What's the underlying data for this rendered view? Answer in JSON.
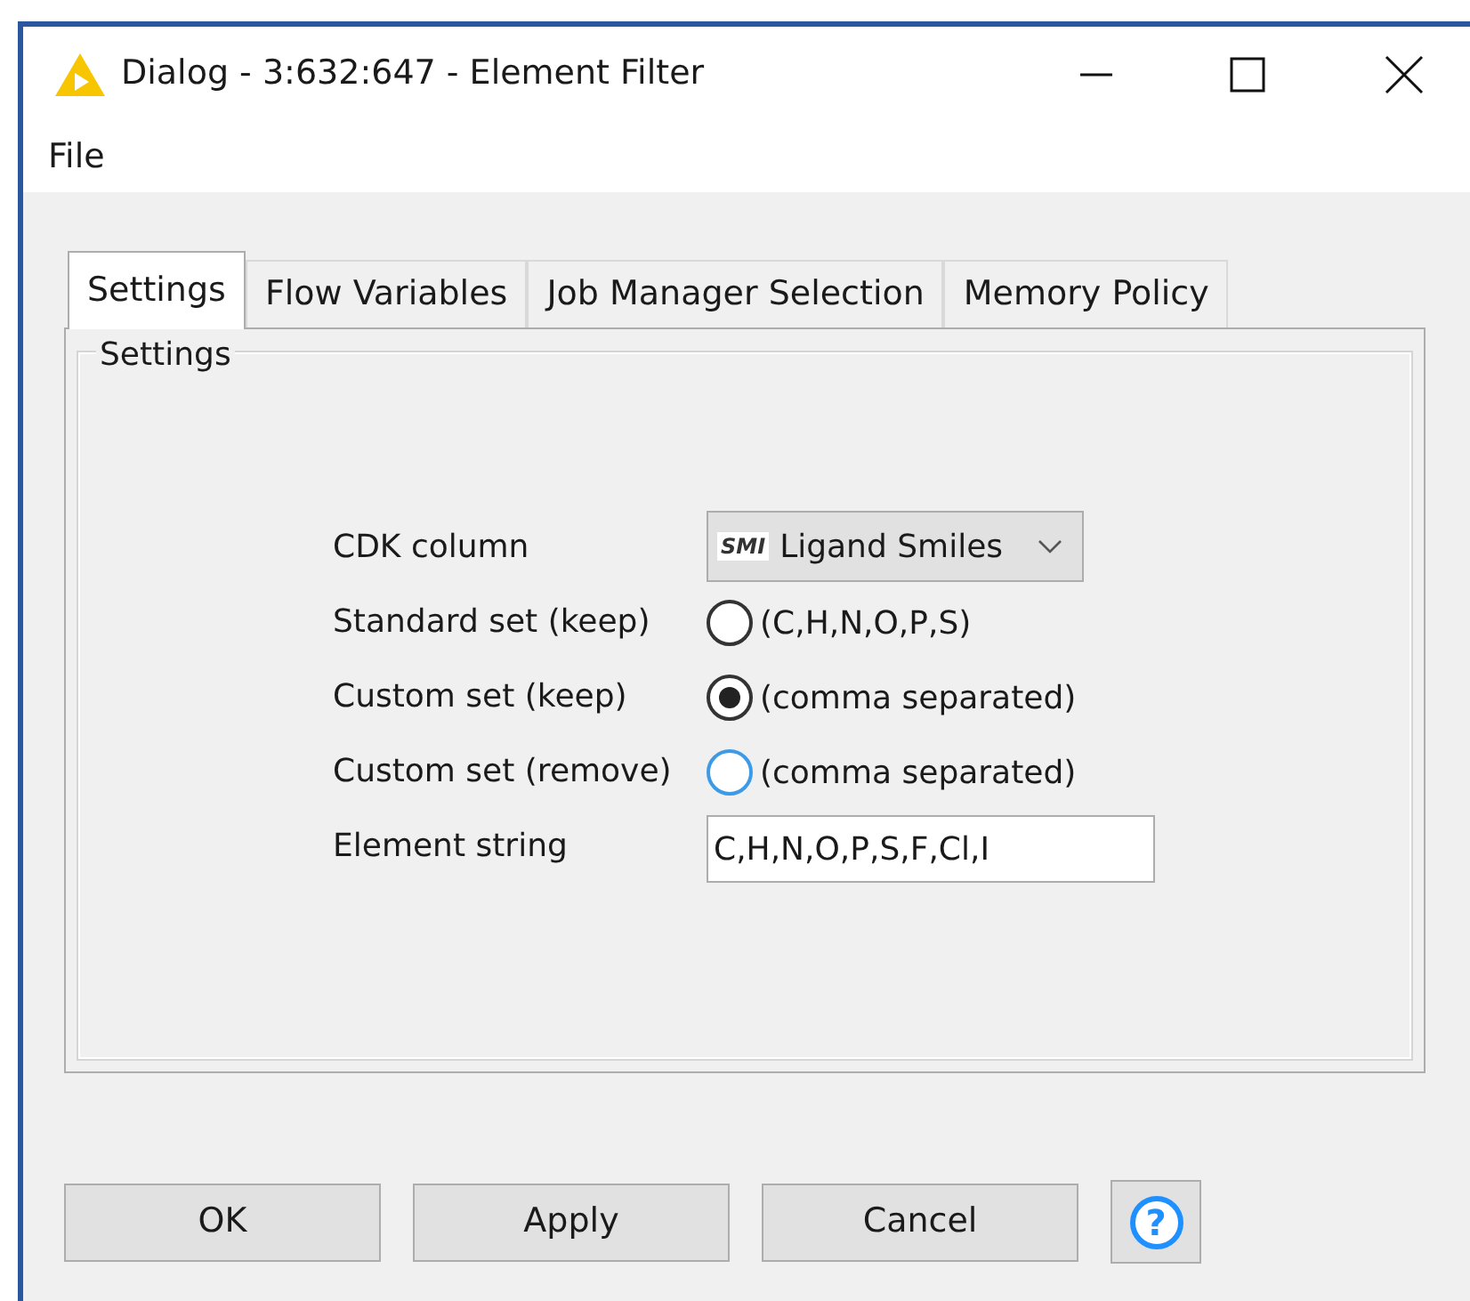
{
  "window": {
    "title": "Dialog - 3:632:647 - Element Filter"
  },
  "menu": [
    "File"
  ],
  "tabs": [
    {
      "label": "Settings",
      "selected": true
    },
    {
      "label": "Flow Variables",
      "selected": false
    },
    {
      "label": "Job Manager Selection",
      "selected": false
    },
    {
      "label": "Memory Policy",
      "selected": false
    }
  ],
  "group": {
    "title": "Settings"
  },
  "form": {
    "column_label": "CDK column",
    "column_value": "Ligand Smiles",
    "column_type_icon": "SMI",
    "radios": [
      {
        "label": "Standard set (keep)",
        "option": "(C,H,N,O,P,S)",
        "selected": false,
        "focused": false
      },
      {
        "label": "Custom set (keep)",
        "option": "(comma separated)",
        "selected": true,
        "focused": false
      },
      {
        "label": "Custom set (remove)",
        "option": "(comma separated)",
        "selected": false,
        "focused": true
      }
    ],
    "element_label": "Element string",
    "element_value": "C,H,N,O,P,S,F,Cl,I"
  },
  "buttons": [
    "OK",
    "Apply",
    "Cancel"
  ],
  "help": "?"
}
